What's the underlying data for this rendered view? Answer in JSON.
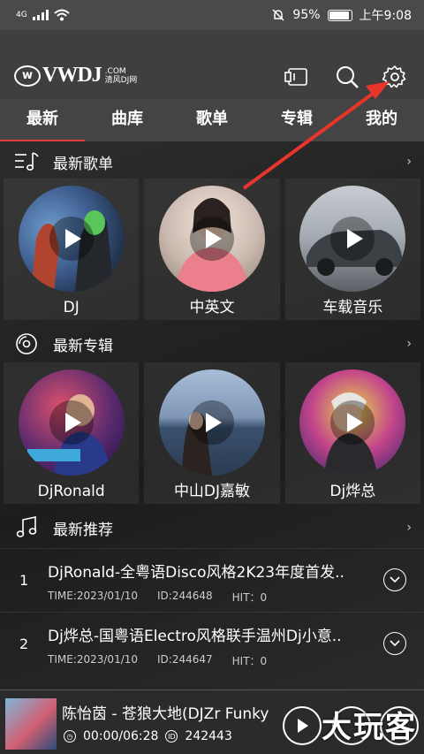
{
  "status": {
    "network": "4G",
    "battery": "95%",
    "time": "上午9:08"
  },
  "logo": {
    "text": "VWDJ",
    "com": ".COM",
    "sub": "清风DJ网"
  },
  "tabs": [
    "最新",
    "曲库",
    "歌单",
    "专辑",
    "我的"
  ],
  "sections": {
    "playlists": {
      "title": "最新歌单",
      "items": [
        "DJ",
        "中英文",
        "车载音乐"
      ]
    },
    "albums": {
      "title": "最新专辑",
      "items": [
        "DjRonald",
        "中山DJ嘉敏",
        "Dj烨总"
      ]
    },
    "recommend": {
      "title": "最新推荐",
      "rows": [
        {
          "num": "1",
          "title": "DjRonald-全粤语Disco风格2K23年度首发..",
          "time": "TIME:2023/01/10",
          "id": "ID:244648",
          "hit": "HIT：0"
        },
        {
          "num": "2",
          "title": "Dj烨总-国粤语Electro风格联手温州Dj小意..",
          "time": "TIME:2023/01/10",
          "id": "ID:244647",
          "hit": "HIT：0"
        }
      ]
    }
  },
  "player": {
    "title": "陈怡茵 - 苍狼大地(DJZr Funky",
    "time": "00:00/06:28",
    "id": "242443"
  },
  "watermark": "大玩客",
  "colors": {
    "accent": "#e23b3b",
    "arrow": "#e8352b"
  }
}
